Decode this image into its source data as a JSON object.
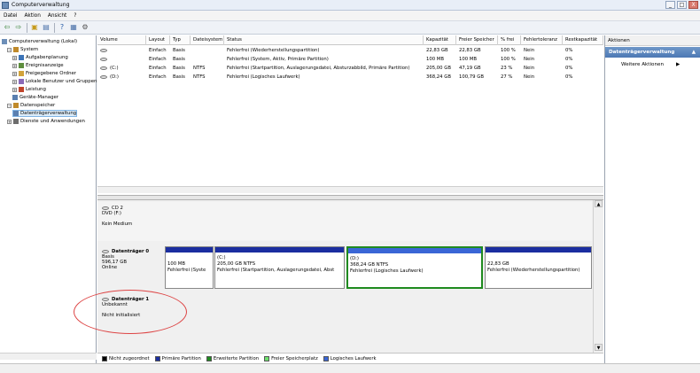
{
  "window": {
    "title": "Computerverwaltung",
    "buttons": [
      "_",
      "□",
      "X"
    ]
  },
  "menu": [
    "Datei",
    "Aktion",
    "Ansicht",
    "?"
  ],
  "toolbar": [
    {
      "icon": "back-arrow-icon",
      "glyph": "⇦",
      "color": "#2a7b2a"
    },
    {
      "icon": "forward-arrow-icon",
      "glyph": "⇨",
      "color": "#2a7b2a"
    },
    {
      "icon": "up-folder-icon",
      "glyph": "▣",
      "color": "#c69a1c"
    },
    {
      "icon": "show-hide-tree-icon",
      "glyph": "▤",
      "color": "#4970a8"
    },
    {
      "icon": "help-icon",
      "glyph": "?",
      "color": "#2a5ea8"
    },
    {
      "icon": "properties-icon",
      "glyph": "▦",
      "color": "#4970a8"
    },
    {
      "icon": "settings-icon",
      "glyph": "⚙",
      "color": "#555555"
    }
  ],
  "tree": [
    {
      "label": "Computerverwaltung (Lokal)",
      "indent": 0,
      "exp": "",
      "icon": "#6d8fb8"
    },
    {
      "label": "System",
      "indent": 1,
      "exp": "−",
      "icon": "#c08a2a"
    },
    {
      "label": "Aufgabenplanung",
      "indent": 2,
      "exp": "+",
      "icon": "#3c74b8"
    },
    {
      "label": "Ereignisanzeige",
      "indent": 2,
      "exp": "+",
      "icon": "#5e8e3e"
    },
    {
      "label": "Freigegebene Ordner",
      "indent": 2,
      "exp": "+",
      "icon": "#d2a33a"
    },
    {
      "label": "Lokale Benutzer und Gruppen",
      "indent": 2,
      "exp": "+",
      "icon": "#8a6ab8"
    },
    {
      "label": "Leistung",
      "indent": 2,
      "exp": "+",
      "icon": "#c0442a"
    },
    {
      "label": "Geräte-Manager",
      "indent": 2,
      "exp": "",
      "icon": "#5a7fb0"
    },
    {
      "label": "Datenspeicher",
      "indent": 1,
      "exp": "−",
      "icon": "#c08a2a"
    },
    {
      "label": "Datenträgerverwaltung",
      "indent": 2,
      "exp": "",
      "icon": "#5a7fb0",
      "selected": true
    },
    {
      "label": "Dienste und Anwendungen",
      "indent": 1,
      "exp": "+",
      "icon": "#6d6d6d"
    }
  ],
  "volume_columns": [
    "Volume",
    "Layout",
    "Typ",
    "Dateisystem",
    "Status",
    "Kapazität",
    "Freier Speicher",
    "% frei",
    "Fehlertoleranz",
    "Restkapazität"
  ],
  "volume_rows": [
    [
      "",
      "Einfach",
      "Basis",
      "",
      "Fehlerfrei (Wiederherstellungspartition)",
      "22,83 GB",
      "22,83 GB",
      "100 %",
      "Nein",
      "0%"
    ],
    [
      "",
      "Einfach",
      "Basis",
      "",
      "Fehlerfrei (System, Aktiv, Primäre Partition)",
      "100 MB",
      "100 MB",
      "100 %",
      "Nein",
      "0%"
    ],
    [
      "(C:)",
      "Einfach",
      "Basis",
      "NTFS",
      "Fehlerfrei (Startpartition, Auslagerungsdatei, Absturzabbild, Primäre Partition)",
      "205,00 GB",
      "47,19 GB",
      "23 %",
      "Nein",
      "0%"
    ],
    [
      "(D:)",
      "Einfach",
      "Basis",
      "NTFS",
      "Fehlerfrei (Logisches Laufwerk)",
      "368,24 GB",
      "100,79 GB",
      "27 %",
      "Nein",
      "0%"
    ]
  ],
  "cdrom": {
    "name": "CD 2",
    "type": "DVD (F:)",
    "status": "Kein Medium"
  },
  "disk0": {
    "name": "Datenträger 0",
    "type": "Basis",
    "size": "596,17 GB",
    "status": "Online",
    "partitions": [
      {
        "line1": "",
        "line2": "100 MB",
        "line3": "Fehlerfrei (Syste"
      },
      {
        "line1": "(C:)",
        "line2": "205,00 GB NTFS",
        "line3": "Fehlerfrei (Startpartition, Auslagerungsdatei, Abst"
      },
      {
        "line1": "(D:)",
        "line2": "368,24 GB NTFS",
        "line3": "Fehlerfrei (Logisches Laufwerk)"
      },
      {
        "line1": "",
        "line2": "22,83 GB",
        "line3": "Fehlerfrei (Wiederherstellungspartition)"
      }
    ]
  },
  "disk1": {
    "name": "Datenträger 1",
    "type": "Unbekannt",
    "status": "Nicht initialisiert"
  },
  "legend": [
    {
      "label": "Nicht zugeordnet",
      "color": "#000000"
    },
    {
      "label": "Primäre Partition",
      "color": "#1b2ea0"
    },
    {
      "label": "Erweiterte Partition",
      "color": "#1f8a1f"
    },
    {
      "label": "Freier Speicherplatz",
      "color": "#6ee06e"
    },
    {
      "label": "Logisches Laufwerk",
      "color": "#3a66d6"
    }
  ],
  "actions": {
    "header": "Aktionen",
    "section": "Datenträgerverwaltung",
    "item": "Weitere Aktionen"
  }
}
